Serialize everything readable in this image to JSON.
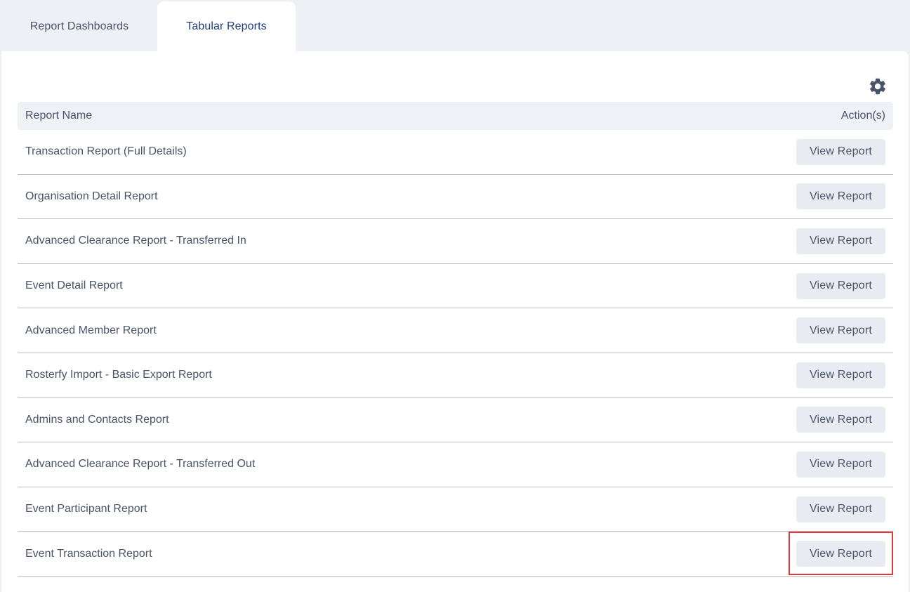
{
  "tabs": [
    {
      "label": "Report Dashboards",
      "active": false
    },
    {
      "label": "Tabular Reports",
      "active": true
    }
  ],
  "settings": {
    "icon": "gear-icon"
  },
  "table": {
    "col_name": "Report Name",
    "col_actions": "Action(s)",
    "rows": [
      {
        "name": "Transaction Report (Full Details)",
        "action": "View Report"
      },
      {
        "name": "Organisation Detail Report",
        "action": "View Report"
      },
      {
        "name": "Advanced Clearance Report - Transferred In",
        "action": "View Report"
      },
      {
        "name": "Event Detail Report",
        "action": "View Report"
      },
      {
        "name": "Advanced Member Report",
        "action": "View Report"
      },
      {
        "name": "Rosterfy Import - Basic Export Report",
        "action": "View Report"
      },
      {
        "name": "Admins and Contacts Report",
        "action": "View Report"
      },
      {
        "name": "Advanced Clearance Report - Transferred Out",
        "action": "View Report"
      },
      {
        "name": "Event Participant Report",
        "action": "View Report"
      },
      {
        "name": "Event Transaction Report",
        "action": "View Report"
      }
    ]
  },
  "colors": {
    "background": "#edf0f5",
    "active_tab_text": "#1f3c7a",
    "text": "#4a5468",
    "button_bg": "#e8ecf2",
    "highlight": "#e0393a"
  }
}
